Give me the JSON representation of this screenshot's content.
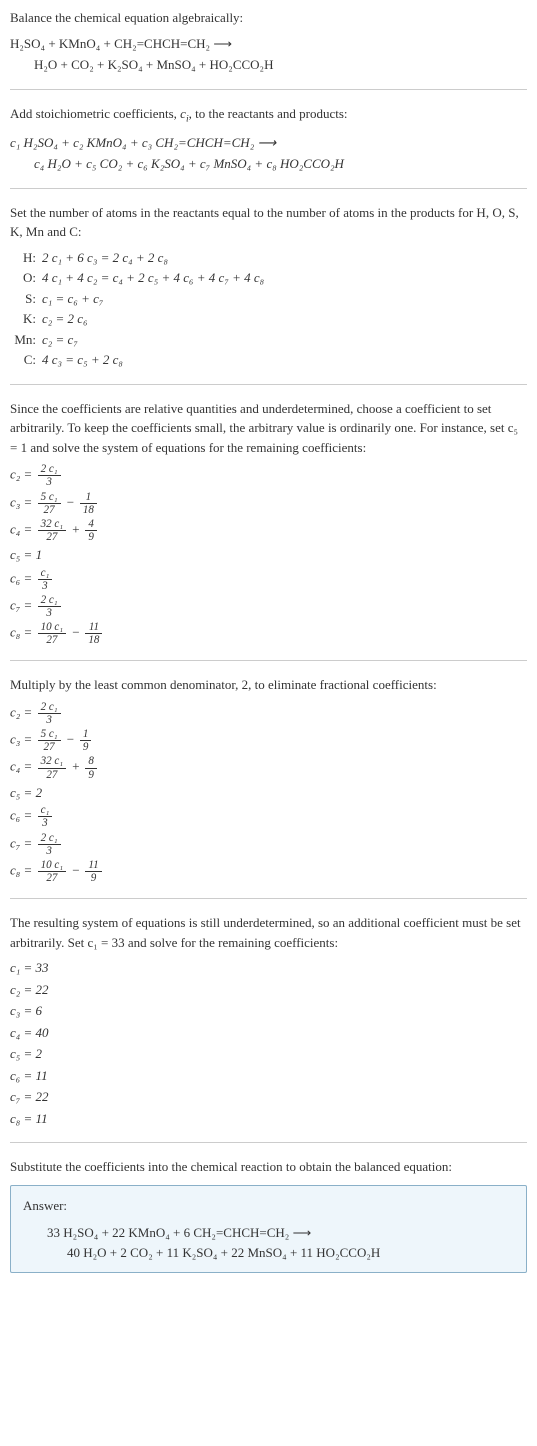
{
  "title": "Balance the chemical equation algebraically:",
  "reaction_line1": "H₂SO₄ + KMnO₄ + CH₂=CHCH=CH₂  ⟶",
  "reaction_line2": "H₂O + CO₂ + K₂SO₄ + MnSO₄ + HO₂CCO₂H",
  "stoich_intro_a": "Add stoichiometric coefficients, ",
  "stoich_intro_ci": "c",
  "stoich_intro_ci_sub": "i",
  "stoich_intro_b": ", to the reactants and products:",
  "stoich_line1_a": "c₁ H₂SO₄ + c₂ KMnO₄ + c₃ CH₂=CHCH=CH₂  ⟶",
  "stoich_line2_a": "c₄ H₂O + c₅ CO₂ + c₆ K₂SO₄ + c₇ MnSO₄ + c₈ HO₂CCO₂H",
  "atoms_intro": "Set the number of atoms in the reactants equal to the number of atoms in the products for H, O, S, K, Mn and C:",
  "atoms": [
    {
      "label": "H:",
      "eq": "2 c₁ + 6 c₃ = 2 c₄ + 2 c₈"
    },
    {
      "label": "O:",
      "eq": "4 c₁ + 4 c₂ = c₄ + 2 c₅ + 4 c₆ + 4 c₇ + 4 c₈"
    },
    {
      "label": "S:",
      "eq": "c₁ = c₆ + c₇"
    },
    {
      "label": "K:",
      "eq": "c₂ = 2 c₆"
    },
    {
      "label": "Mn:",
      "eq": "c₂ = c₇"
    },
    {
      "label": "C:",
      "eq": "4 c₃ = c₅ + 2 c₈"
    }
  ],
  "under1_intro": "Since the coefficients are relative quantities and underdetermined, choose a coefficient to set arbitrarily. To keep the coefficients small, the arbitrary value is ordinarily one. For instance, set c₅ = 1 and solve the system of equations for the remaining coefficients:",
  "set1": [
    {
      "lhs": "c₂ =",
      "num": "2 c₁",
      "den": "3"
    },
    {
      "lhs": "c₃ =",
      "num": "5 c₁",
      "den": "27",
      "op": "−",
      "num2": "1",
      "den2": "18"
    },
    {
      "lhs": "c₄ =",
      "num": "32 c₁",
      "den": "27",
      "op": "+",
      "num2": "4",
      "den2": "9"
    },
    {
      "lhs": "c₅ =",
      "plain": "1"
    },
    {
      "lhs": "c₆ =",
      "num": "c₁",
      "den": "3"
    },
    {
      "lhs": "c₇ =",
      "num": "2 c₁",
      "den": "3"
    },
    {
      "lhs": "c₈ =",
      "num": "10 c₁",
      "den": "27",
      "op": "−",
      "num2": "11",
      "den2": "18"
    }
  ],
  "mult_intro": "Multiply by the least common denominator, 2, to eliminate fractional coefficients:",
  "set2": [
    {
      "lhs": "c₂ =",
      "num": "2 c₁",
      "den": "3"
    },
    {
      "lhs": "c₃ =",
      "num": "5 c₁",
      "den": "27",
      "op": "−",
      "num2": "1",
      "den2": "9"
    },
    {
      "lhs": "c₄ =",
      "num": "32 c₁",
      "den": "27",
      "op": "+",
      "num2": "8",
      "den2": "9"
    },
    {
      "lhs": "c₅ =",
      "plain": "2"
    },
    {
      "lhs": "c₆ =",
      "num": "c₁",
      "den": "3"
    },
    {
      "lhs": "c₇ =",
      "num": "2 c₁",
      "den": "3"
    },
    {
      "lhs": "c₈ =",
      "num": "10 c₁",
      "den": "27",
      "op": "−",
      "num2": "11",
      "den2": "9"
    }
  ],
  "under2_intro": "The resulting system of equations is still underdetermined, so an additional coefficient must be set arbitrarily. Set c₁ = 33 and solve for the remaining coefficients:",
  "finals": [
    "c₁ = 33",
    "c₂ = 22",
    "c₃ = 6",
    "c₄ = 40",
    "c₅ = 2",
    "c₆ = 11",
    "c₇ = 22",
    "c₈ = 11"
  ],
  "sub_intro": "Substitute the coefficients into the chemical reaction to obtain the balanced equation:",
  "answer_label": "Answer:",
  "answer_line1": "33 H₂SO₄ + 22 KMnO₄ + 6 CH₂=CHCH=CH₂  ⟶",
  "answer_line2": "40 H₂O + 2 CO₂ + 11 K₂SO₄ + 22 MnSO₄ + 11 HO₂CCO₂H"
}
